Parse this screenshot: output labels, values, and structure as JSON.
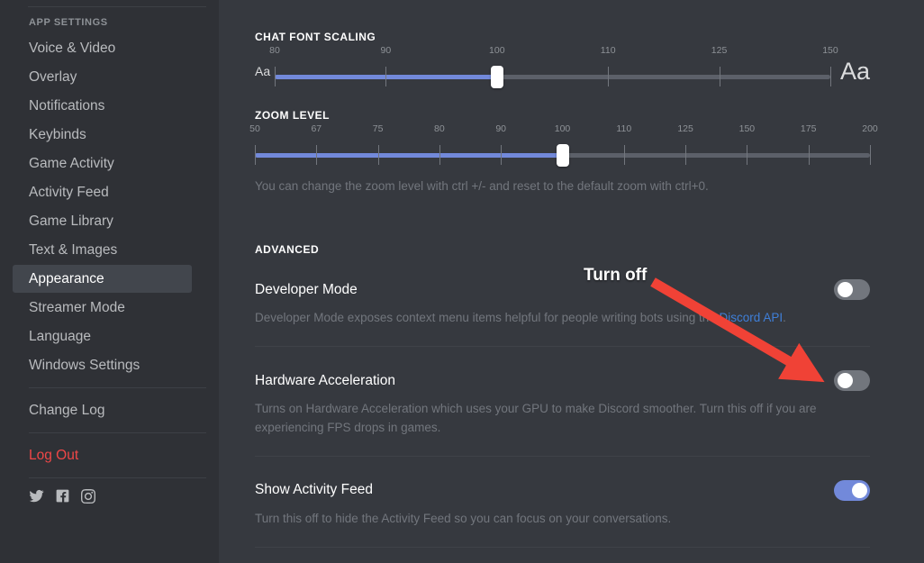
{
  "sidebar": {
    "header": "APP SETTINGS",
    "items": [
      {
        "label": "Voice & Video",
        "active": false,
        "danger": false
      },
      {
        "label": "Overlay",
        "active": false,
        "danger": false
      },
      {
        "label": "Notifications",
        "active": false,
        "danger": false
      },
      {
        "label": "Keybinds",
        "active": false,
        "danger": false
      },
      {
        "label": "Game Activity",
        "active": false,
        "danger": false
      },
      {
        "label": "Activity Feed",
        "active": false,
        "danger": false
      },
      {
        "label": "Game Library",
        "active": false,
        "danger": false
      },
      {
        "label": "Text & Images",
        "active": false,
        "danger": false
      },
      {
        "label": "Appearance",
        "active": true,
        "danger": false
      },
      {
        "label": "Streamer Mode",
        "active": false,
        "danger": false
      },
      {
        "label": "Language",
        "active": false,
        "danger": false
      },
      {
        "label": "Windows Settings",
        "active": false,
        "danger": false
      }
    ],
    "change_log": "Change Log",
    "log_out": "Log Out",
    "socials": [
      "twitter-icon",
      "facebook-icon",
      "instagram-icon"
    ]
  },
  "main": {
    "chat_font_scaling": {
      "title": "CHAT FONT SCALING",
      "small_label": "Aa",
      "large_label": "Aa",
      "value": 100,
      "ticks": [
        80,
        90,
        100,
        110,
        125,
        150
      ]
    },
    "zoom_level": {
      "title": "ZOOM LEVEL",
      "value": 100,
      "ticks": [
        50,
        67,
        75,
        80,
        90,
        100,
        110,
        125,
        150,
        175,
        200
      ],
      "hint": "You can change the zoom level with ctrl +/- and reset to the default zoom with ctrl+0."
    },
    "advanced": {
      "title": "ADVANCED",
      "settings": [
        {
          "name": "Developer Mode",
          "desc_before": "Developer Mode exposes context menu items helpful for people writing bots using the ",
          "desc_link": "Discord API",
          "desc_after": ".",
          "enabled": false
        },
        {
          "name": "Hardware Acceleration",
          "desc_before": "Turns on Hardware Acceleration which uses your GPU to make Discord smoother. Turn this off if you are experiencing FPS drops in games.",
          "desc_link": "",
          "desc_after": "",
          "enabled": false
        },
        {
          "name": "Show Activity Feed",
          "desc_before": "Turn this off to hide the Activity Feed so you can focus on your conversations.",
          "desc_link": "",
          "desc_after": "",
          "enabled": true
        }
      ]
    }
  },
  "annotation": {
    "text": "Turn off",
    "arrow_color": "#f04236"
  },
  "colors": {
    "sidebar_bg": "#2f3136",
    "main_bg": "#36393f",
    "accent": "#7289da",
    "danger": "#f04747",
    "link": "#3f7fd8"
  }
}
